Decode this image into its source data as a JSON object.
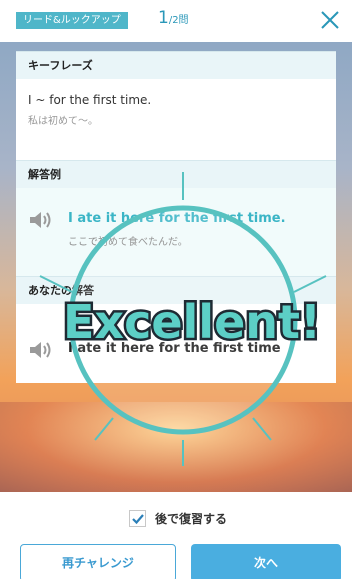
{
  "header": {
    "mode_badge": "リード&ルックアップ",
    "progress_current": "1",
    "progress_total": "/2問"
  },
  "card": {
    "key_phrase_heading": "キーフレーズ",
    "key_phrase_en": "I ~ for the first time.",
    "key_phrase_jp": "私は初めて〜。",
    "answer_heading": "解答例",
    "answer_en": "I ate it here for the first time.",
    "answer_jp": "ここで初めて食べたんだ。",
    "your_answer_heading": "あなたの解答",
    "your_answer_en": "I ate it here for the first time"
  },
  "result": {
    "feedback_text": "Excellent!"
  },
  "footer": {
    "review_checked": true,
    "review_label": "後で復習する",
    "retry_label": "再チャレンジ",
    "next_label": "次へ"
  },
  "colors": {
    "accent": "#4aaee0",
    "answer_text": "#3bb5c6",
    "badge": "#4fb6c9",
    "ring": "#57c2c0"
  },
  "icons": [
    "close-icon",
    "speaker-icon",
    "checkmark-icon"
  ]
}
